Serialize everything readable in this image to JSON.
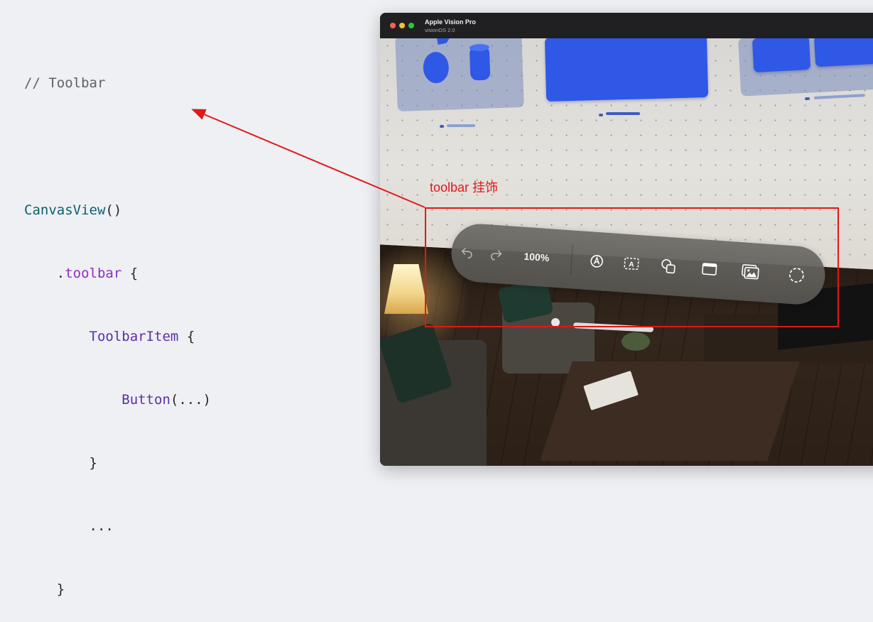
{
  "code": {
    "comment": "// Toolbar",
    "canvas_view": "CanvasView",
    "canvas_parens": "()",
    "dot": ".",
    "toolbar_modifier": "toolbar",
    "open_brace": "{",
    "toolbar_item": "ToolbarItem",
    "button": "Button",
    "button_args": "(...)",
    "close_brace": "}",
    "ellipsis": "..."
  },
  "window": {
    "title": "Apple Vision Pro",
    "subtitle": "visionOS 2.0"
  },
  "toolbar": {
    "zoom_level": "100%",
    "buttons": [
      {
        "icon": "undo-icon",
        "enabled": false
      },
      {
        "icon": "redo-icon",
        "enabled": false
      },
      {
        "icon": "pencil-tip-icon",
        "enabled": true
      },
      {
        "icon": "text-box-icon",
        "enabled": true
      },
      {
        "icon": "shapes-icon",
        "enabled": true
      },
      {
        "icon": "window-icon",
        "enabled": true
      },
      {
        "icon": "photos-icon",
        "enabled": true
      },
      {
        "icon": "lasso-icon",
        "enabled": true
      }
    ]
  },
  "annotation": {
    "label": "toolbar 挂饰",
    "color": "#e01818"
  },
  "colors": {
    "page_background": "#eef0f3",
    "code_type": "#0b5f6f",
    "code_member": "#8e2fbf",
    "code_symbol": "#5b2ea8",
    "window_blue": "#2f58e6"
  }
}
